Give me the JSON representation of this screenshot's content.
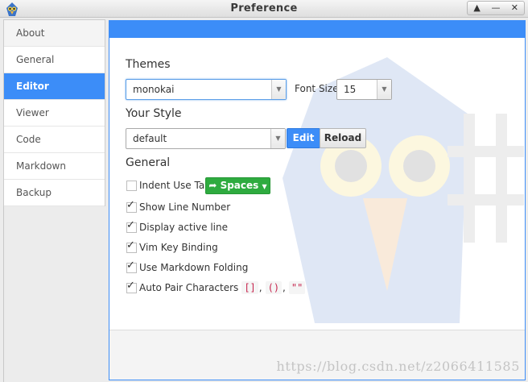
{
  "window": {
    "title": "Preference",
    "controls": [
      "▲",
      "—",
      "✕"
    ]
  },
  "sidebar": {
    "items": [
      {
        "label": "About"
      },
      {
        "label": "General"
      },
      {
        "label": "Editor",
        "active": true
      },
      {
        "label": "Viewer"
      },
      {
        "label": "Code"
      },
      {
        "label": "Markdown"
      },
      {
        "label": "Backup"
      }
    ]
  },
  "themes": {
    "heading": "Themes",
    "selected": "monokai"
  },
  "font_size": {
    "label": "Font Size",
    "value": "15"
  },
  "your_style": {
    "heading": "Your Style",
    "selected": "default",
    "edit_label": "Edit",
    "reload_label": "Reload"
  },
  "general": {
    "heading": "General",
    "indent": {
      "label": "Indent Use Tab",
      "checked": false,
      "button_label": "Spaces"
    },
    "show_line_number": {
      "label": "Show Line Number",
      "checked": true
    },
    "display_active_line": {
      "label": "Display active line",
      "checked": true
    },
    "vim_key_binding": {
      "label": "Vim Key Binding",
      "checked": true
    },
    "markdown_folding": {
      "label": "Use Markdown Folding",
      "checked": true
    },
    "auto_pair": {
      "label": "Auto Pair Characters",
      "checked": true,
      "chips": [
        "[]",
        "()",
        "\"\""
      ],
      "separator": ","
    }
  },
  "colors": {
    "accent": "#3c8df8",
    "success": "#2eab3f",
    "code": "#c7254e"
  },
  "watermark": "https://blog.csdn.net/z2066411585"
}
